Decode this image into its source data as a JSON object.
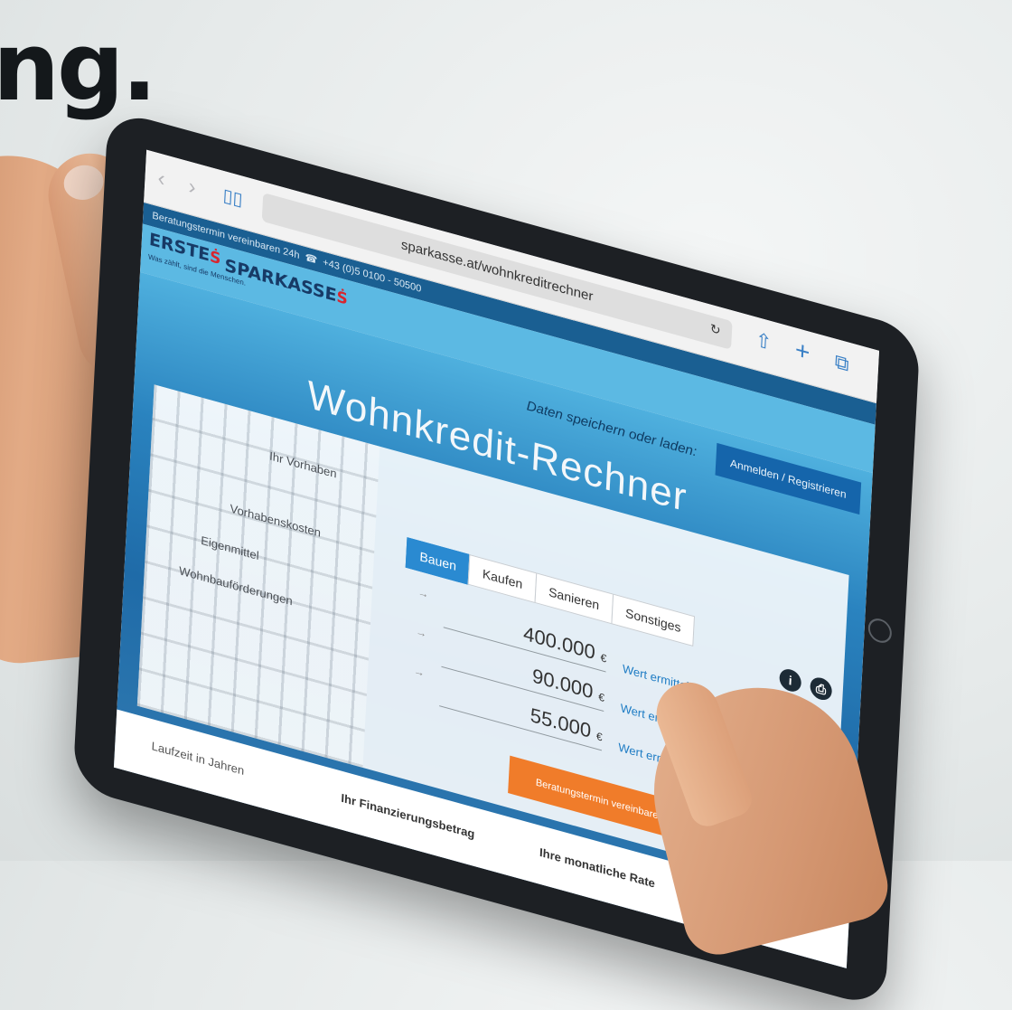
{
  "headline": "ng.",
  "browser": {
    "url": "sparkasse.at/wohnkreditrechner"
  },
  "site": {
    "topbar_text": "Beratungstermin vereinbaren 24h",
    "phone": "+43 (0)5 0100 - 50500",
    "logo_erste": "ERSTE",
    "logo_sparkasse": "SPARKASSE",
    "claim": "Was zählt, sind die Menschen.",
    "save_label": "Daten speichern oder laden:",
    "login_label": "Anmelden / Registrieren"
  },
  "calculator": {
    "title": "Wohnkredit-Rechner",
    "labels": {
      "vorhaben": "Ihr Vorhaben",
      "kosten": "Vorhabenskosten",
      "eigenmittel": "Eigenmittel",
      "foerderungen": "Wohnbauförderungen"
    },
    "tabs": [
      "Bauen",
      "Kaufen",
      "Sanieren",
      "Sonstiges"
    ],
    "values": {
      "kosten": "400.000",
      "eigenmittel": "90.000",
      "foerderungen": "55.000"
    },
    "currency": "€",
    "wert_link": "Wert ermitteln >",
    "cta_label": "Beratungstermin vereinbaren",
    "results": {
      "laufzeit": "Laufzeit in Jahren",
      "betrag": "Ihr Finanzierungsbetrag",
      "rate": "Ihre monatliche Rate"
    }
  },
  "icons": {
    "info": "i",
    "print": "print-icon"
  }
}
